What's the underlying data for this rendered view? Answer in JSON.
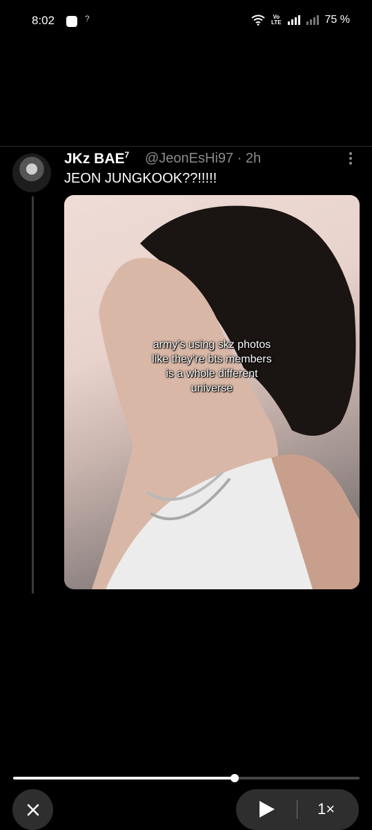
{
  "status_bar": {
    "time": "8:02",
    "sim_label": "?",
    "volte_line1": "Vo",
    "volte_line2": "LTE",
    "battery": "75 %"
  },
  "tweet": {
    "display_name": "JKz BAE",
    "badge": "7",
    "handle_time": "@JeonEsHi97 · 2h",
    "text": "JEON JUNGKOOK??!!!!!",
    "media_caption": "army’s using skz photos\nlike they’re  bts members\nis a whole different\nuniverse"
  },
  "player": {
    "progress_fraction": 0.64,
    "close_icon": "×",
    "play_icon": "play-icon",
    "speed_label": "1×"
  }
}
